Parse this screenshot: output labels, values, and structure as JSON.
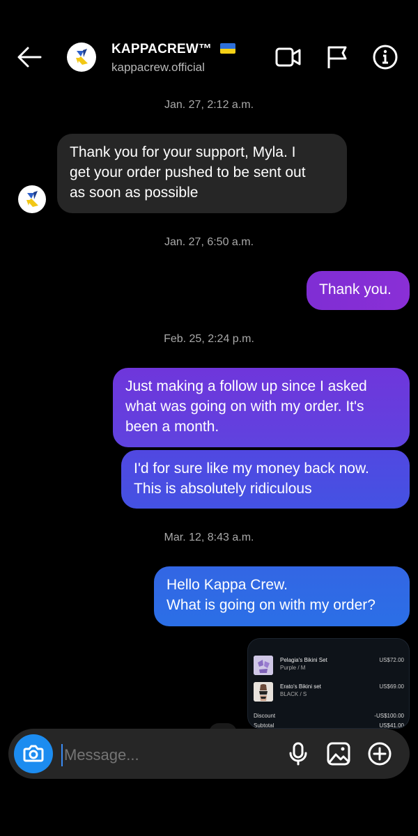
{
  "header": {
    "title": "KAPPACREW™",
    "username": "kappacrew.official",
    "icons": [
      "back-arrow-icon",
      "video-call-icon",
      "flag-icon",
      "info-icon"
    ]
  },
  "messages": [
    {
      "type": "timestamp",
      "text": "Jan. 27, 2:12 a.m."
    },
    {
      "type": "incoming",
      "lines": [
        "Thank you for your support, Myla. I",
        "get your order pushed to be sent out",
        "as soon as possible"
      ]
    },
    {
      "type": "timestamp",
      "text": "Jan. 27, 6:50 a.m."
    },
    {
      "type": "outgoing",
      "lines": [
        "Thank you."
      ]
    },
    {
      "type": "timestamp",
      "text": "Feb. 25, 2:24 p.m."
    },
    {
      "type": "outgoing",
      "lines": [
        "Just making a follow up since I asked",
        "what was going on with my order. It's",
        "been a month."
      ]
    },
    {
      "type": "outgoing",
      "lines": [
        "I'd for sure like my money back now.",
        "This is absolutely ridiculous"
      ]
    },
    {
      "type": "timestamp",
      "text": "Mar. 12, 8:43 a.m."
    },
    {
      "type": "outgoing",
      "lines": [
        "Hello Kappa Crew.",
        "What is going on with my order?"
      ]
    }
  ],
  "receipt": {
    "items": [
      {
        "name": "Pelagia's Bikini Set",
        "variant": "Purple / M",
        "price": "US$72.00"
      },
      {
        "name": "Erato's Bikini set",
        "variant": "BLACK / S",
        "price": "US$69.00"
      }
    ],
    "discount_label": "Discount",
    "discount_value": "-US$100.00",
    "subtotal_label": "Subtotal",
    "subtotal_value": "US$41.00"
  },
  "composer": {
    "placeholder": "Message...",
    "icons": [
      "camera-icon",
      "microphone-icon",
      "gallery-icon",
      "plus-icon"
    ]
  },
  "colors": {
    "background": "#000000",
    "incoming_bubble": "#262626",
    "outgoing_gradient": [
      "#7b2fd6",
      "#6a3fe0",
      "#4a4ee6",
      "#2f6fe6"
    ],
    "camera_button": "#1c8cf0"
  }
}
